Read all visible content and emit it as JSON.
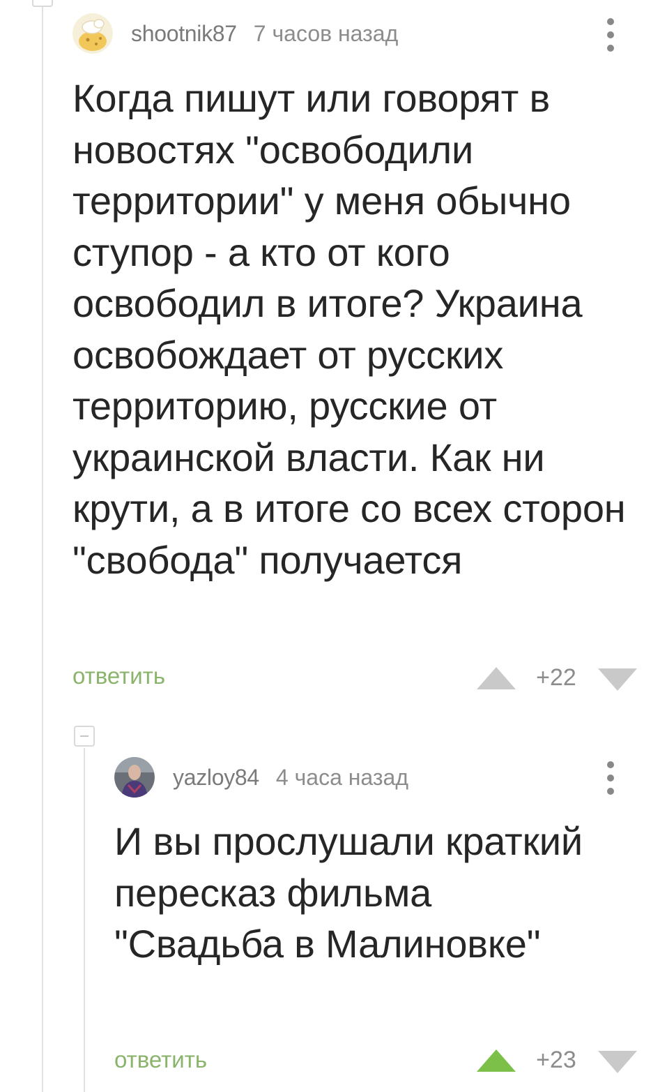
{
  "comments": [
    {
      "username": "shootnik87",
      "timestamp": "7 часов назад",
      "text": "Когда пишут или говорят в новостях \"освободили территории\" у меня обычно ступор - а кто от кого освободил в итоге? Украина освобождает от русских территорию, русские от украинской власти. Как ни крути, а в итоге со всех сторон \"свобода\" получается",
      "reply_label": "ответить",
      "rating": "+22",
      "avatar_icon": "cartoon-avatar-icon",
      "upvoted": false
    },
    {
      "username": "yazloy84",
      "timestamp": "4 часа назад",
      "text": "И вы прослушали краткий пересказ фильма \"Свадьба в Малиновке\"",
      "reply_label": "ответить",
      "rating": "+23",
      "avatar_icon": "photo-avatar-icon",
      "upvoted": true
    }
  ],
  "colors": {
    "accent_green": "#8ab46c",
    "upvote_active": "#7cc04a",
    "vote_inactive": "#c9c9c9",
    "text": "#262626",
    "meta": "#8c8c8c"
  }
}
